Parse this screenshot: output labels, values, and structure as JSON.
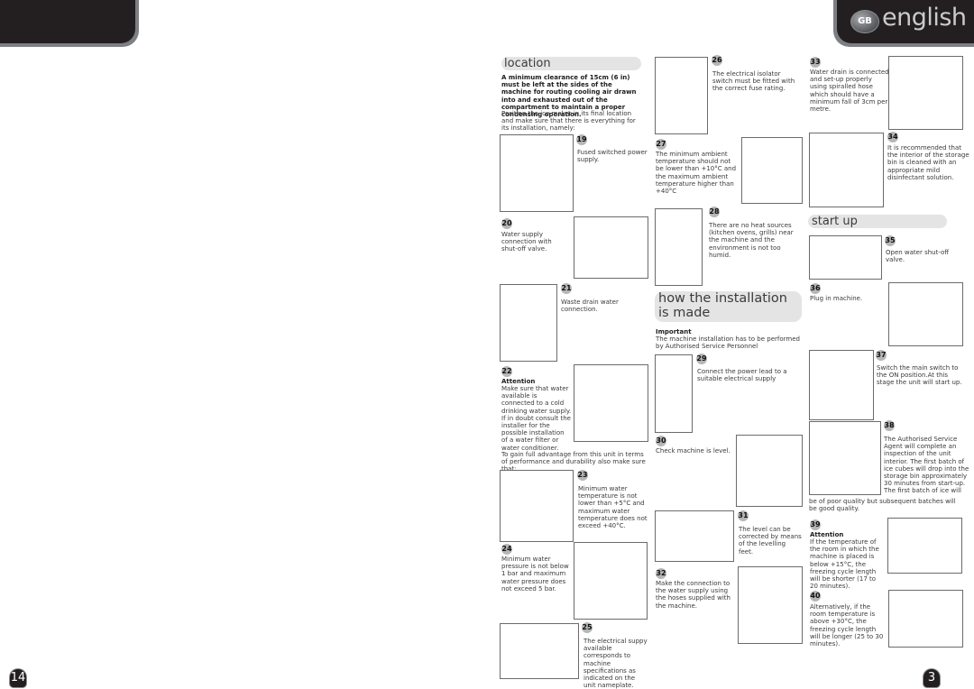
{
  "header": {
    "lang_badge": "GB",
    "lang_label": "english"
  },
  "page_numbers": {
    "left": "14",
    "right": "3"
  },
  "sections": {
    "location": "location",
    "how_installation": "how the installation is made",
    "start_up": "start up"
  },
  "location": {
    "intro_bold": "A minimum clearance of 15cm (6 in) must be left at the sides of the machine for routing cooling air drawn into and exhausted out of the compartment to maintain a proper condensing operation.",
    "intro_text": "Position the ice maker in its final location and make sure that there is everything for its installation, namely:",
    "mid_text": "To gain full advantage from this unit in terms of performance and durability also make sure that:"
  },
  "installation": {
    "important_label": "Important",
    "important_text": "The machine installation has to be performed by Authorised Service Personnel"
  },
  "steps": {
    "s19": {
      "num": "19",
      "text": "Fused switched power supply."
    },
    "s20": {
      "num": "20",
      "text": "Water supply connection with shut-off valve."
    },
    "s21": {
      "num": "21",
      "text": "Waste drain water connection."
    },
    "s22": {
      "num": "22",
      "label": "Attention",
      "text": "Make sure that water available is connected to a cold drinking water supply. If in doubt consult the installer for the possible installation of a water filter or water conditioner."
    },
    "s23": {
      "num": "23",
      "text": "Minimum water temperature is not lower than +5°C and maximum water temperature does not exceed +40°C."
    },
    "s24": {
      "num": "24",
      "text": "Minimum water pressure is not below 1 bar and maximum water pressure does not exceed 5 bar."
    },
    "s25": {
      "num": "25",
      "text": "The electrical suppy available corresponds to machine specifications as indicated on the unit nameplate."
    },
    "s26": {
      "num": "26",
      "text": "The electrical isolator switch must be fitted with the correct fuse rating."
    },
    "s27": {
      "num": "27",
      "text": "The minimum ambient temperature should not be lower than +10°C and the maximum ambient temperature higher than +40°C"
    },
    "s28": {
      "num": "28",
      "text": "There are no heat sources (kitchen ovens, grills) near the machine and the environment is not too humid."
    },
    "s29": {
      "num": "29",
      "text": "Connect the power lead to a suitable electrical supply"
    },
    "s30": {
      "num": "30",
      "text": "Check machine is level."
    },
    "s31": {
      "num": "31",
      "text": "The level can be corrected by means of the levelling feet."
    },
    "s32": {
      "num": "32",
      "text": "Make the connection to the water supply using the hoses supplied with the machine."
    },
    "s33": {
      "num": "33",
      "text": "Water drain is connected and set-up properly using spiralled hose which should have a minimum fall of 3cm per metre."
    },
    "s34": {
      "num": "34",
      "text": "It is recommended that the interior of the storage bin is cleaned with an appropriate mild disinfectant solution."
    },
    "s35": {
      "num": "35",
      "text": "Open water shut-off valve."
    },
    "s36": {
      "num": "36",
      "text": "Plug in machine."
    },
    "s37": {
      "num": "37",
      "text": "Switch the main switch to the ON position.At this stage the unit will start up."
    },
    "s38": {
      "num": "38",
      "text_a": "The Authorised Service Agent will complete an inspection of the unit interior. The first batch of ice cubes will drop into the storage bin approximately 30 minutes from start-up. The first batch of ice will",
      "text_b": "be of poor quality but subsequent batches will be good  quality."
    },
    "s39": {
      "num": "39",
      "label": "Attention",
      "text": "If the temperature of the room in which the machine is placed is below +15°C, the freezing cycle length will be shorter (17 to 20 minutes)."
    },
    "s40": {
      "num": "40",
      "text": "Alternatively, if the room temperature is above +30°C, the freezing cycle length will be longer (25 to 30 minutes)."
    }
  }
}
